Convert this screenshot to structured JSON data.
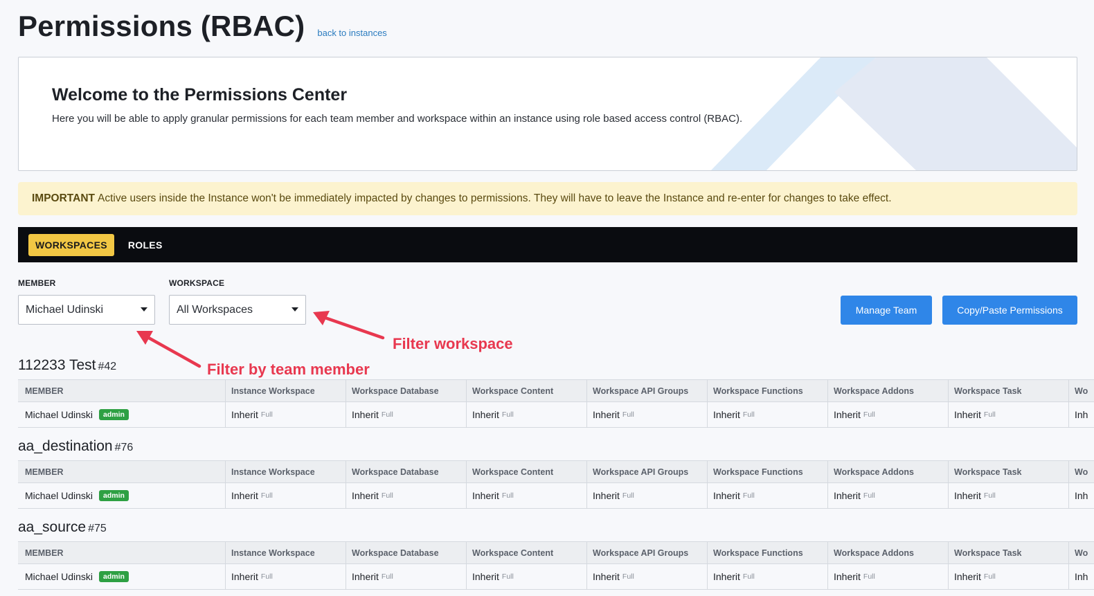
{
  "header": {
    "title": "Permissions (RBAC)",
    "back_link": "back to instances"
  },
  "welcome": {
    "heading": "Welcome to the Permissions Center",
    "text": "Here you will be able to apply granular permissions for each team member and workspace within an instance using role based access control (RBAC)."
  },
  "notice": {
    "label": "IMPORTANT",
    "text": "Active users inside the Instance won't be immediately impacted by changes to permissions. They will have to leave the Instance and re-enter for changes to take effect."
  },
  "tabs": [
    {
      "label": "WORKSPACES",
      "active": true
    },
    {
      "label": "ROLES",
      "active": false
    }
  ],
  "filters": {
    "member": {
      "label": "MEMBER",
      "value": "Michael Udinski"
    },
    "workspace": {
      "label": "WORKSPACE",
      "value": "All Workspaces"
    }
  },
  "actions": {
    "manage_team": "Manage Team",
    "copy_paste": "Copy/Paste Permissions"
  },
  "annotations": {
    "filter_workspace": "Filter workspace",
    "filter_member": "Filter by team member"
  },
  "columns": [
    "MEMBER",
    "Instance Workspace",
    "Workspace Database",
    "Workspace Content",
    "Workspace API Groups",
    "Workspace Functions",
    "Workspace Addons",
    "Workspace Task",
    "Wo"
  ],
  "workspaces": [
    {
      "name": "112233 Test",
      "id": "#42",
      "rows": [
        {
          "member": "Michael Udinski",
          "badge": "admin",
          "perms": [
            "Inherit",
            "Inherit",
            "Inherit",
            "Inherit",
            "Inherit",
            "Inherit",
            "Inherit",
            "Inh"
          ],
          "perm_sub": "Full"
        }
      ]
    },
    {
      "name": "aa_destination",
      "id": "#76",
      "rows": [
        {
          "member": "Michael Udinski",
          "badge": "admin",
          "perms": [
            "Inherit",
            "Inherit",
            "Inherit",
            "Inherit",
            "Inherit",
            "Inherit",
            "Inherit",
            "Inh"
          ],
          "perm_sub": "Full"
        }
      ]
    },
    {
      "name": "aa_source",
      "id": "#75",
      "rows": [
        {
          "member": "Michael Udinski",
          "badge": "admin",
          "perms": [
            "Inherit",
            "Inherit",
            "Inherit",
            "Inherit",
            "Inherit",
            "Inherit",
            "Inherit",
            "Inh"
          ],
          "perm_sub": "Full"
        }
      ]
    }
  ],
  "colors": {
    "accent_tab": "#f2c744",
    "button": "#2f86e8",
    "badge": "#2ea043",
    "annotation": "#e8384f",
    "notice_bg": "#fcf3cf"
  }
}
